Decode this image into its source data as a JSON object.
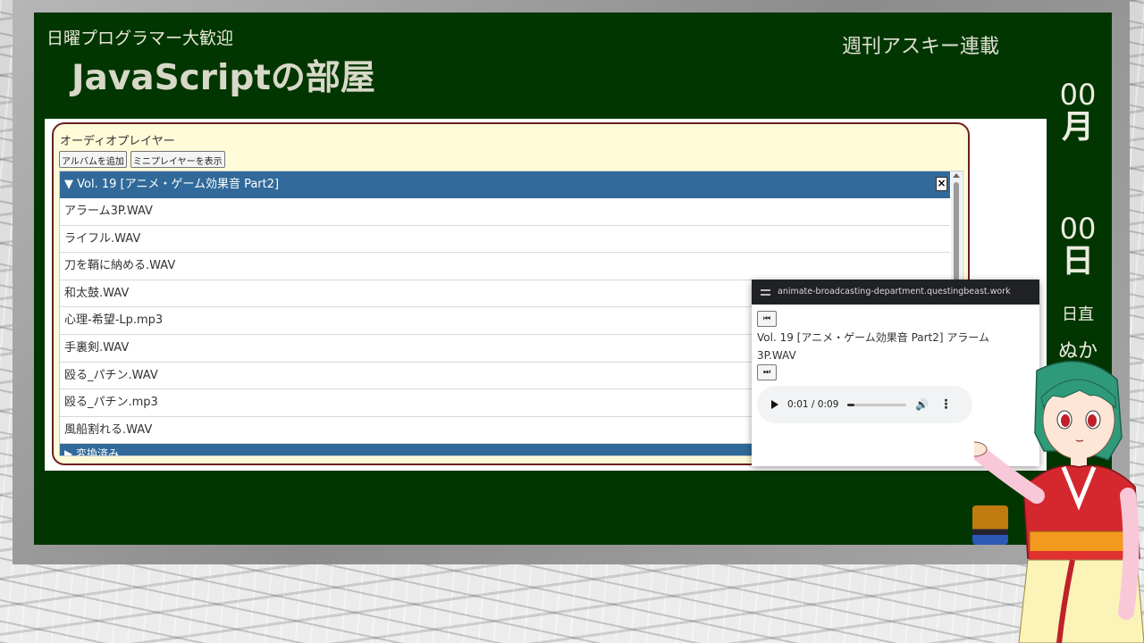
{
  "board": {
    "subtitle": "日曜プログラマー大歓迎",
    "title": "JavaScriptの部屋",
    "right_title": "週刊アスキー連載",
    "date_month_num": "00",
    "date_month_unit": "月",
    "date_day_num": "00",
    "date_day_unit": "日",
    "duty_label": "日直",
    "duty_name": "ぬか"
  },
  "player": {
    "title": "オーディオプレイヤー",
    "add_album_label": "アルバムを追加",
    "show_mini_label": "ミニプレイヤーを表示",
    "album_title": "▼ Vol. 19 [アニメ・ゲーム効果音 Part2]",
    "close_label": "×",
    "tracks": [
      "アラーム3P.WAV",
      "ライフル.WAV",
      "刀を鞘に納める.WAV",
      "和太鼓.WAV",
      "心理-希望-Lp.mp3",
      "手裏剣.WAV",
      "殴る_パチン.WAV",
      "殴る_パチン.mp3",
      "風船割れる.WAV"
    ],
    "next_album_title": "▶ 変換済み"
  },
  "mini_player": {
    "url": "animate-broadcasting-department.questingbeast.work",
    "prev_label": "⏮",
    "now_playing": "Vol. 19 [アニメ・ゲーム効果音 Part2] アラーム3P.WAV",
    "next_label": "⏭",
    "time": "0:01 / 0:09",
    "progress_fraction": 0.11
  },
  "colors": {
    "board": "#023600",
    "album_header": "#316a9a",
    "player_bg": "#fffbd8",
    "player_border": "#6b2020"
  }
}
